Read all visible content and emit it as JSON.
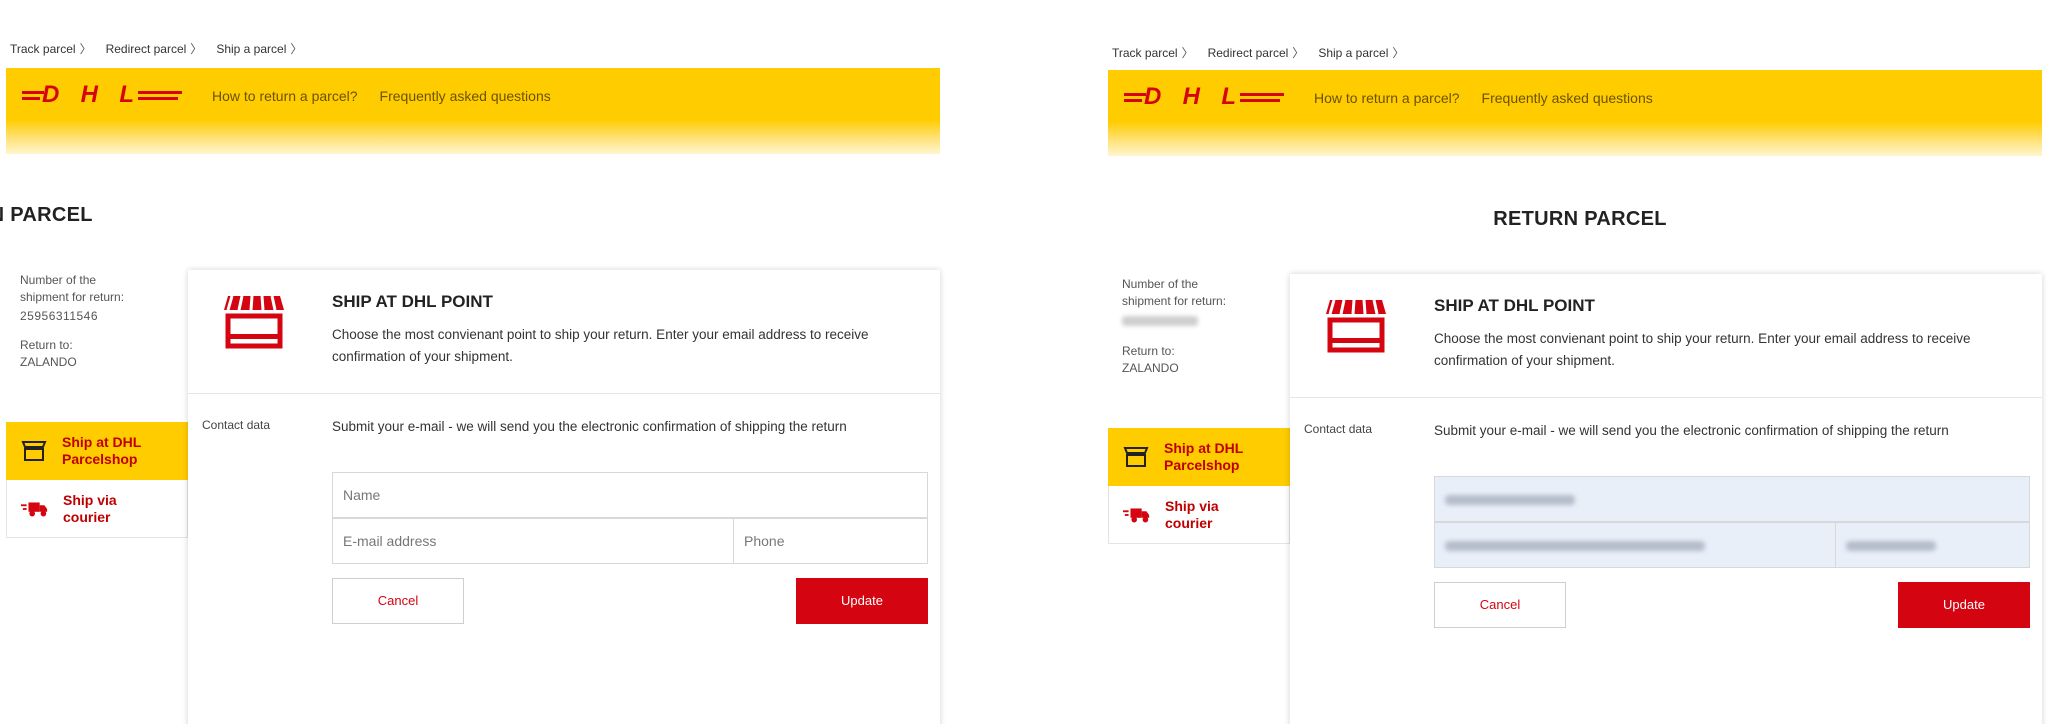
{
  "panels": [
    {
      "breadcrumbs": [
        "Track parcel",
        "Redirect parcel",
        "Ship a parcel"
      ],
      "header": {
        "logo": "DHL",
        "links": [
          "How to return a parcel?",
          "Frequently asked questions"
        ]
      },
      "page_title": "RETURN PARCEL",
      "shipment": {
        "number_label": "Number of the shipment for return:",
        "number": "25956311546",
        "return_to_label": "Return to:",
        "return_to": "ZALANDO"
      },
      "nav": {
        "shop_label": "Ship at DHL Parcelshop",
        "courier_label": "Ship via courier"
      },
      "card": {
        "title": "SHIP AT DHL POINT",
        "description": "Choose the most convienant point to ship your return. Enter your email address to receive confirmation of your shipment.",
        "contact_label": "Contact data",
        "contact_desc": "Submit your e-mail - we will send you the electronic confirmation of shipping the return",
        "name_placeholder": "Name",
        "email_placeholder": "E-mail address",
        "phone_placeholder": "Phone",
        "cancel": "Cancel",
        "update": "Update"
      }
    },
    {
      "breadcrumbs": [
        "Track parcel",
        "Redirect parcel",
        "Ship a parcel"
      ],
      "header": {
        "logo": "DHL",
        "links": [
          "How to return a parcel?",
          "Frequently asked questions"
        ]
      },
      "page_title": "RETURN PARCEL",
      "shipment": {
        "number_label": "Number of the shipment for return:",
        "return_to_label": "Return to:",
        "return_to": "ZALANDO"
      },
      "nav": {
        "shop_label": "Ship at DHL Parcelshop",
        "courier_label": "Ship via courier"
      },
      "card": {
        "title": "SHIP AT DHL POINT",
        "description": "Choose the most convienant point to ship your return. Enter your email address to receive confirmation of your shipment.",
        "contact_label": "Contact data",
        "contact_desc": "Submit your e-mail - we will send you the electronic confirmation of shipping the return",
        "cancel": "Cancel",
        "update": "Update"
      }
    }
  ],
  "colors": {
    "dhl_yellow": "#ffcc00",
    "dhl_red": "#d40511",
    "filled_field": "#e8eff9"
  }
}
